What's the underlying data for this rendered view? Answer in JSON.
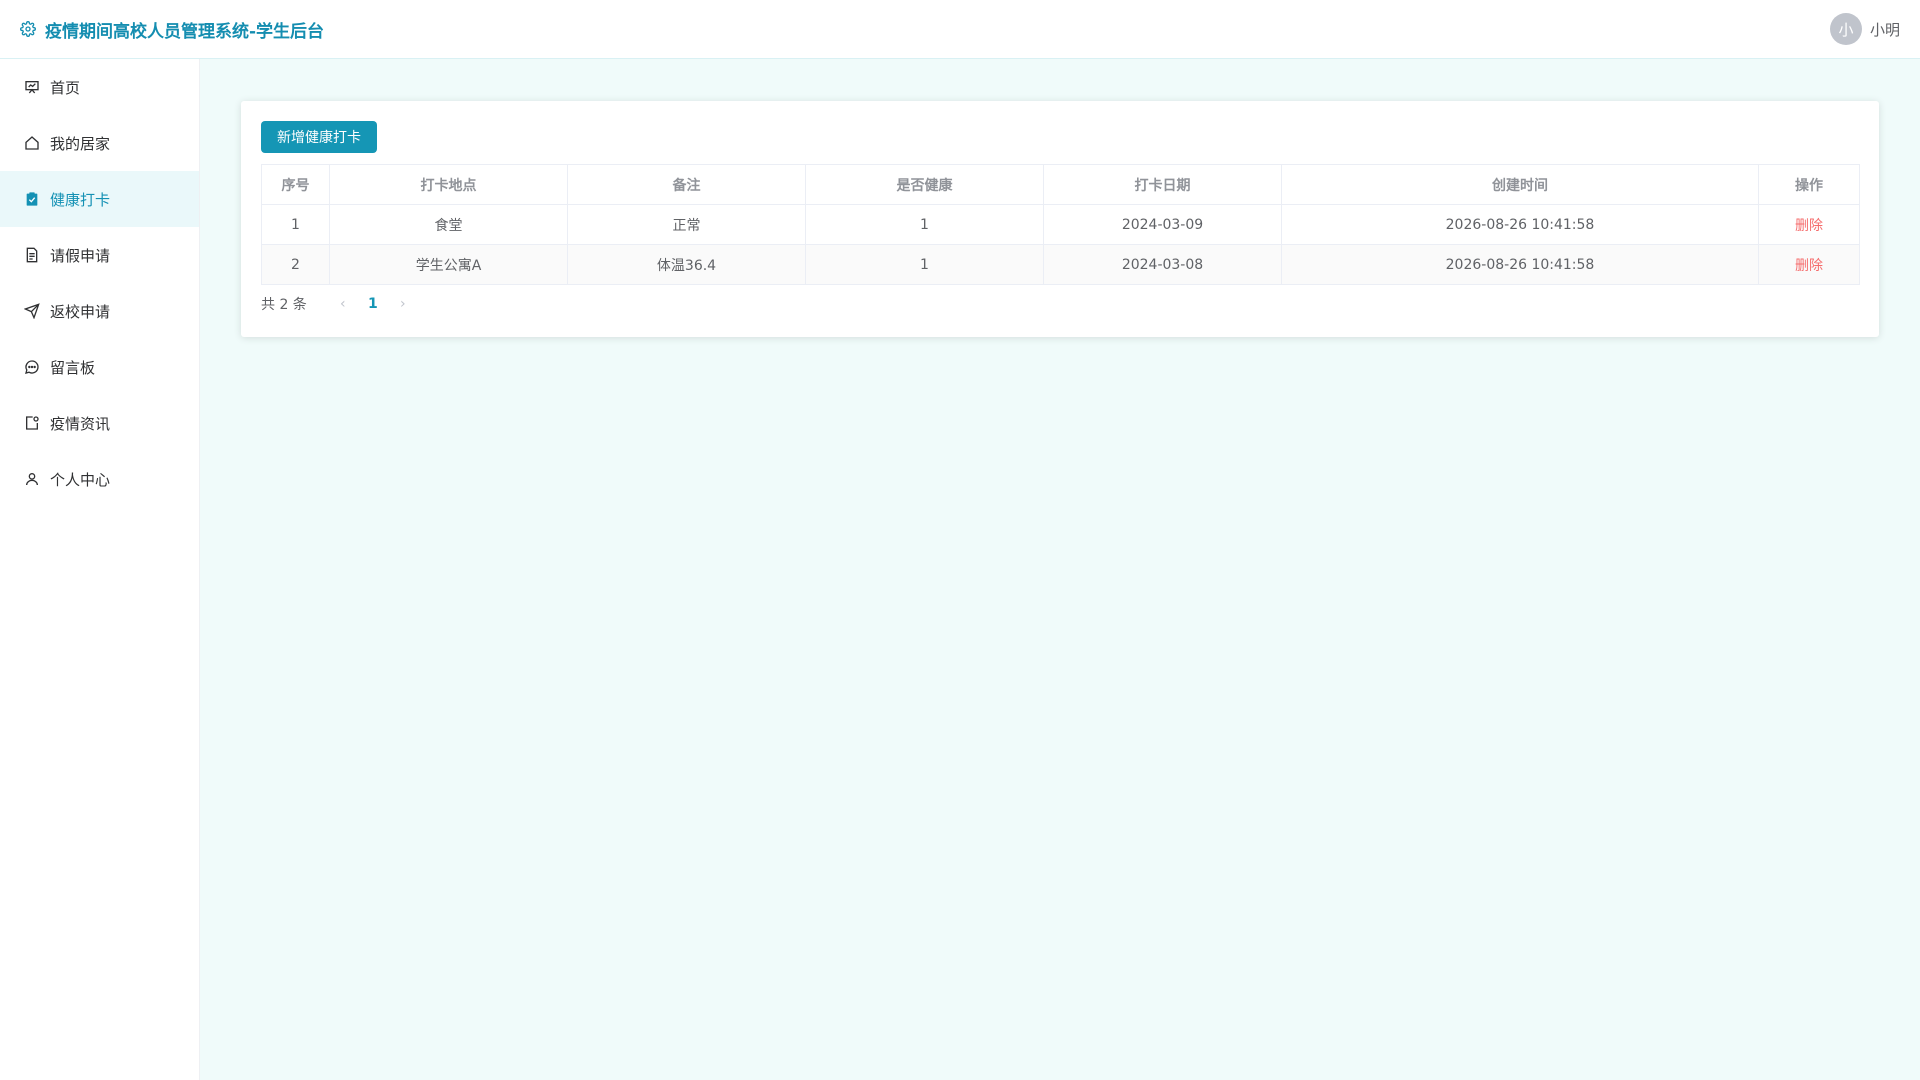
{
  "app": {
    "title": "疫情期间高校人员管理系统-学生后台",
    "logo_icon": "gear-icon",
    "brand_color": "#148db0"
  },
  "user": {
    "avatar_text": "小",
    "name": "小明"
  },
  "sidebar": {
    "items": [
      {
        "label": "首页",
        "icon": "presentation-icon"
      },
      {
        "label": "我的居家",
        "icon": "home-icon"
      },
      {
        "label": "健康打卡",
        "icon": "clipboard-check-icon",
        "active": true
      },
      {
        "label": "请假申请",
        "icon": "document-icon"
      },
      {
        "label": "返校申请",
        "icon": "send-icon"
      },
      {
        "label": "留言板",
        "icon": "chat-icon"
      },
      {
        "label": "疫情资讯",
        "icon": "news-icon"
      },
      {
        "label": "个人中心",
        "icon": "user-icon"
      }
    ]
  },
  "toolbar": {
    "add_label": "新增健康打卡"
  },
  "table": {
    "headers": [
      "序号",
      "打卡地点",
      "备注",
      "是否健康",
      "打卡日期",
      "创建时间",
      "操作"
    ],
    "rows": [
      {
        "index": "1",
        "location": "食堂",
        "note": "正常",
        "healthy": "1",
        "date": "2024-03-09",
        "created": "2026-08-26 10:41:58",
        "action": "删除"
      },
      {
        "index": "2",
        "location": "学生公寓A",
        "note": "体温36.4",
        "healthy": "1",
        "date": "2024-03-08",
        "created": "2026-08-26 10:41:58",
        "action": "删除"
      }
    ]
  },
  "pagination": {
    "total_text": "共 2 条",
    "current_page": "1"
  },
  "colors": {
    "accent": "#1596b5",
    "danger": "#f56c6c",
    "page_bg": "#f0fbfa",
    "active_bg": "#eaf8fa"
  }
}
